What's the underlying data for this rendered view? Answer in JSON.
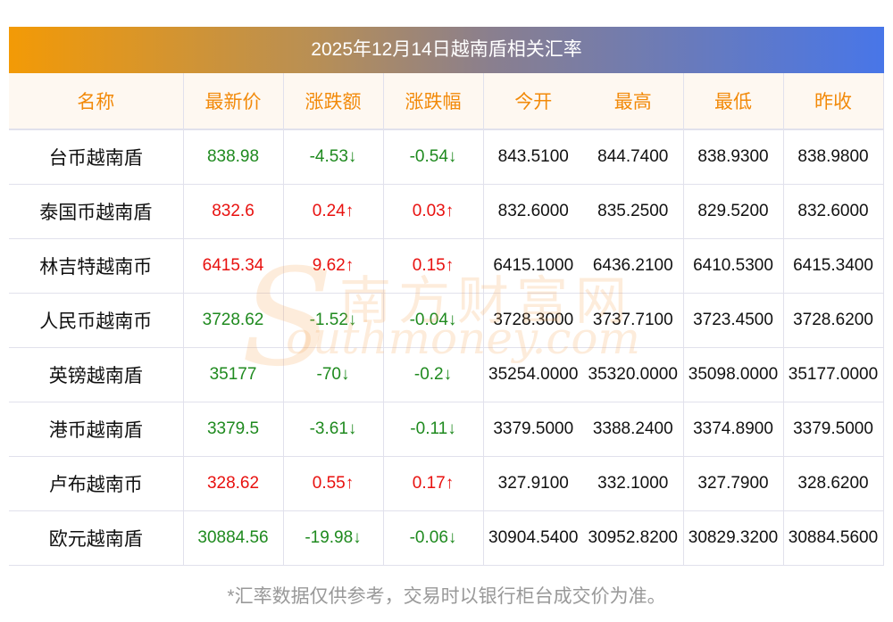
{
  "title": "2025年12月14日越南盾相关汇率",
  "headers": [
    "名称",
    "最新价",
    "涨跌额",
    "涨跌幅",
    "今开",
    "最高",
    "最低",
    "昨收"
  ],
  "rows": [
    {
      "name": "台币越南盾",
      "price": "838.98",
      "chg": "-4.53↓",
      "pct": "-0.54↓",
      "open": "843.5100",
      "high": "844.7400",
      "low": "838.9300",
      "prev": "838.9800",
      "dir": "down"
    },
    {
      "name": "泰国币越南盾",
      "price": "832.6",
      "chg": "0.24↑",
      "pct": "0.03↑",
      "open": "832.6000",
      "high": "835.2500",
      "low": "829.5200",
      "prev": "832.6000",
      "dir": "up"
    },
    {
      "name": "林吉特越南币",
      "price": "6415.34",
      "chg": "9.62↑",
      "pct": "0.15↑",
      "open": "6415.1000",
      "high": "6436.2100",
      "low": "6410.5300",
      "prev": "6415.3400",
      "dir": "up"
    },
    {
      "name": "人民币越南币",
      "price": "3728.62",
      "chg": "-1.52↓",
      "pct": "-0.04↓",
      "open": "3728.3000",
      "high": "3737.7100",
      "low": "3723.4500",
      "prev": "3728.6200",
      "dir": "down"
    },
    {
      "name": "英镑越南盾",
      "price": "35177",
      "chg": "-70↓",
      "pct": "-0.2↓",
      "open": "35254.0000",
      "high": "35320.0000",
      "low": "35098.0000",
      "prev": "35177.0000",
      "dir": "down"
    },
    {
      "name": "港币越南盾",
      "price": "3379.5",
      "chg": "-3.61↓",
      "pct": "-0.11↓",
      "open": "3379.5000",
      "high": "3388.2400",
      "low": "3374.8900",
      "prev": "3379.5000",
      "dir": "down"
    },
    {
      "name": "卢布越南币",
      "price": "328.62",
      "chg": "0.55↑",
      "pct": "0.17↑",
      "open": "327.9100",
      "high": "332.1000",
      "low": "327.7900",
      "prev": "328.6200",
      "dir": "up"
    },
    {
      "name": "欧元越南盾",
      "price": "30884.56",
      "chg": "-19.98↓",
      "pct": "-0.06↓",
      "open": "30904.5400",
      "high": "30952.8200",
      "low": "30829.3200",
      "prev": "30884.5600",
      "dir": "down"
    }
  ],
  "watermark": {
    "cn": "南方财富网",
    "en": "outhmoney.com",
    "s": "S"
  },
  "footer": "*汇率数据仅供参考，交易时以银行柜台成交价为准。",
  "colors": {
    "up": "#e8110f",
    "down": "#1f8a1f",
    "header": "#f28a0a"
  }
}
